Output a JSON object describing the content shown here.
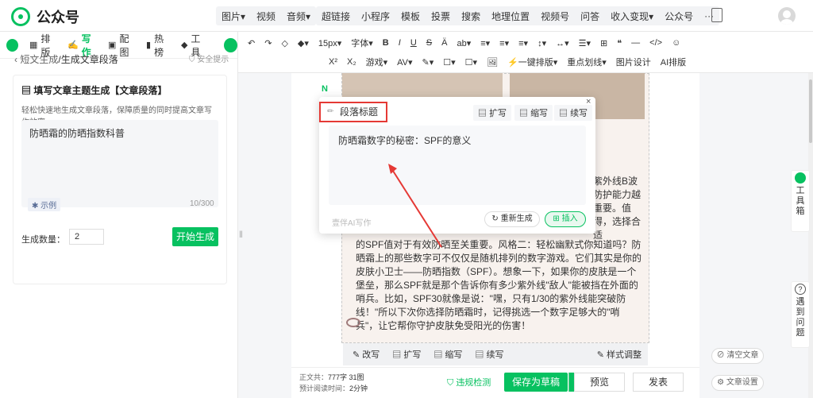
{
  "app": {
    "name": "公众号"
  },
  "topmenu": {
    "group1": [
      "图片▾",
      "视频",
      "音频▾"
    ],
    "group2": [
      "超链接",
      "小程序",
      "模板",
      "投票",
      "搜索",
      "地理位置",
      "视频号",
      "问答",
      "收入变现▾",
      "公众号",
      "···"
    ]
  },
  "lefttabs": [
    {
      "icon": "layout-icon",
      "label": "排版"
    },
    {
      "icon": "ai-write-icon",
      "label": "写作"
    },
    {
      "icon": "image-icon",
      "label": "配图"
    },
    {
      "icon": "hot-icon",
      "label": "热榜"
    },
    {
      "icon": "tool-icon",
      "label": "工具"
    }
  ],
  "breadcrumb": {
    "back": "短文生成",
    "current": "/生成文章段落"
  },
  "safe_tip": "安全提示",
  "card": {
    "title": "填写文章主题生成【文章段落】",
    "desc": "轻松快速地生成文章段落，保障质量的同时提高文章写作效率",
    "topic": "防晒霜的防晒指数科普",
    "example": "示例",
    "counter": "10/300",
    "count_label": "生成数量：",
    "count_value": "2",
    "generate": "开始生成"
  },
  "toolbar": {
    "row1": [
      "↶",
      "↷",
      "◇",
      "◆▾",
      "15px▾",
      "字体▾",
      "B",
      "I",
      "U",
      "S",
      "Ä",
      "ab▾",
      "≡▾",
      "≡▾",
      "≡▾",
      "↕▾",
      "↔▾",
      "☰▾",
      "⊞",
      "❝",
      "—",
      "</>",
      "☺"
    ],
    "row2": [
      "X²",
      "X₂",
      "游戏▾",
      "AV▾",
      "✎▾",
      "☐▾",
      "☐▾",
      "🖼",
      "⚡一键排版▾",
      "重点划线▾",
      "图片设计",
      "AI排版"
    ]
  },
  "popup": {
    "title": "段落标题",
    "actions": [
      "扩写",
      "缩写",
      "续写"
    ],
    "close": "×",
    "content": "防晒霜数字的秘密：SPF的意义",
    "ai_brand": "壹伴AI写作",
    "regenerate": "重新生成",
    "insert": "插入"
  },
  "article": {
    "right_peek": "紫外线B波防护能力越重要。值得，选择合适",
    "body": "的SPF值对于有效防晒至关重要。风格二：轻松幽默式你知道吗？防晒霜上的那些数字可不仅仅是随机排列的数字游戏。它们其实是你的皮肤小卫士——防晒指数（SPF）。想象一下，如果你的皮肤是一个堡垒，那么SPF就是那个告诉你有多少紫外线\"敌人\"能被挡在外面的哨兵。比如，SPF30就像是说：\"嘿，只有1/30的紫外线能突破防线！\"所以下次你选择防晒霜时，记得挑选一个数字足够大的\"哨兵\"，让它帮你守护皮肤免受阳光的伤害！"
  },
  "ai_bar": {
    "items": [
      "改写",
      "扩写",
      "缩写",
      "续写"
    ],
    "style": "样式调整"
  },
  "footer": {
    "body_label": "正文共：",
    "body_value": "777字 31图",
    "read_label": "预计阅读时间：",
    "read_value": "2分钟",
    "violation": "违规检测",
    "save": "保存为草稿",
    "preview": "预览",
    "publish": "发表"
  },
  "side": {
    "toolbox": "工具箱",
    "help": "遇到问题",
    "clear": "清空文章",
    "settings": "文章设置"
  },
  "colors": {
    "brand": "#07c160",
    "highlight": "#e53935"
  }
}
